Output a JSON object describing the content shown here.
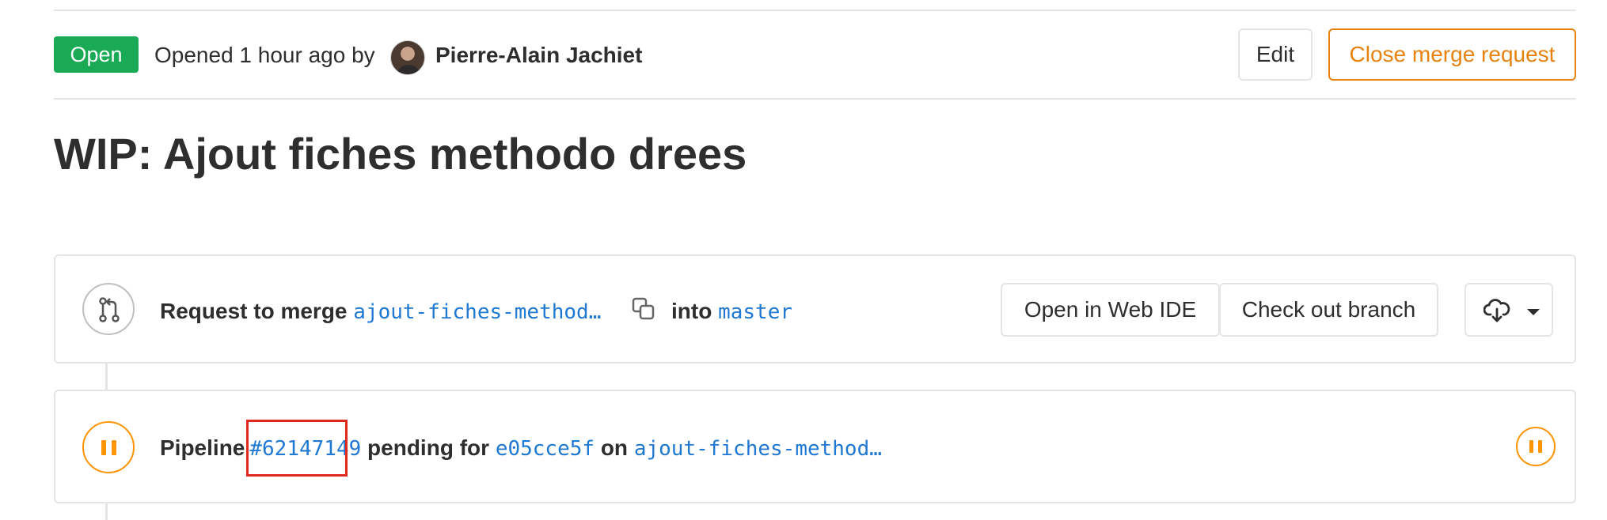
{
  "header": {
    "status_badge": "Open",
    "opened_prefix": "Opened 1 hour ago by",
    "author_name": "Pierre-Alain Jachiet",
    "edit_label": "Edit",
    "close_label": "Close merge request"
  },
  "title": "WIP: Ajout fiches methodo drees",
  "merge_widget": {
    "request_prefix": "Request to merge",
    "source_branch": "ajout-fiches-method…",
    "into_label": "into",
    "target_branch": "master",
    "open_ide_label": "Open in Web IDE",
    "checkout_label": "Check out branch",
    "icons": [
      "git-merge-icon",
      "copy-icon",
      "download-cloud-icon",
      "chevron-down-icon"
    ]
  },
  "pipeline_widget": {
    "prefix": "Pipeline",
    "pipeline_id": "#62147149",
    "status_text": "pending for",
    "commit_sha": "e05cce5f",
    "on_label": "on",
    "branch": "ajout-fiches-method…",
    "status": "pending",
    "status_color": "#fc9403"
  },
  "colors": {
    "open_badge": "#1aaa55",
    "link": "#1f78d1",
    "warning": "#e8820e",
    "highlight": "#e0281e"
  }
}
